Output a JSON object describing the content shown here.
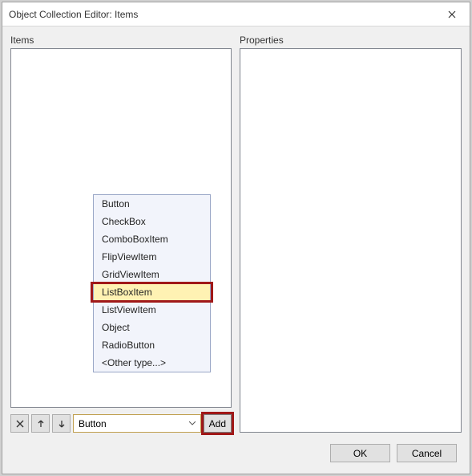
{
  "window": {
    "title": "Object Collection Editor: Items"
  },
  "labels": {
    "items": "Items",
    "properties": "Properties"
  },
  "toolbar": {
    "selected_type": "Button",
    "add_label": "Add"
  },
  "dropdown": {
    "options": [
      "Button",
      "CheckBox",
      "ComboBoxItem",
      "FlipViewItem",
      "GridViewItem",
      "ListBoxItem",
      "ListViewItem",
      "Object",
      "RadioButton",
      "<Other type...>"
    ],
    "selected_index": 5
  },
  "footer": {
    "ok": "OK",
    "cancel": "Cancel"
  }
}
